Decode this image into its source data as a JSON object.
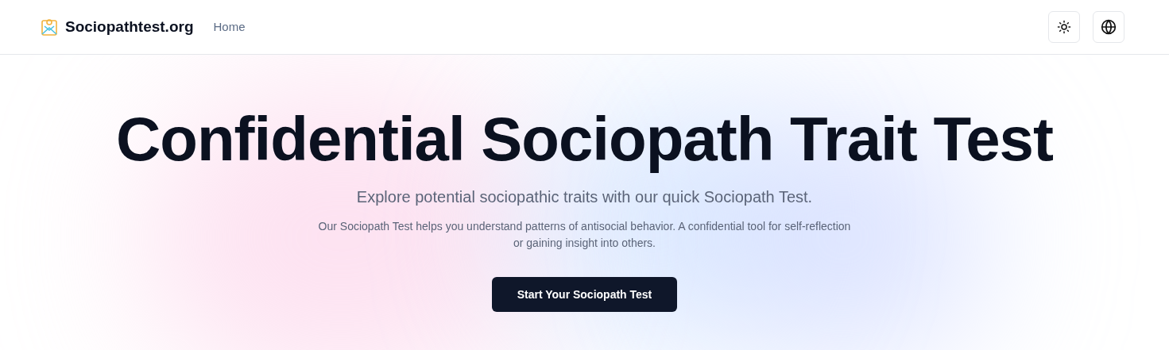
{
  "header": {
    "site_name": "Sociopathtest.org",
    "nav": [
      {
        "label": "Home"
      }
    ]
  },
  "hero": {
    "title": "Confidential Sociopath Trait Test",
    "subtitle": "Explore potential sociopathic traits with our quick Sociopath Test.",
    "description": "Our Sociopath Test helps you understand patterns of antisocial behavior. A confidential tool for self-reflection or gaining insight into others.",
    "button": "Start Your Sociopath Test"
  }
}
